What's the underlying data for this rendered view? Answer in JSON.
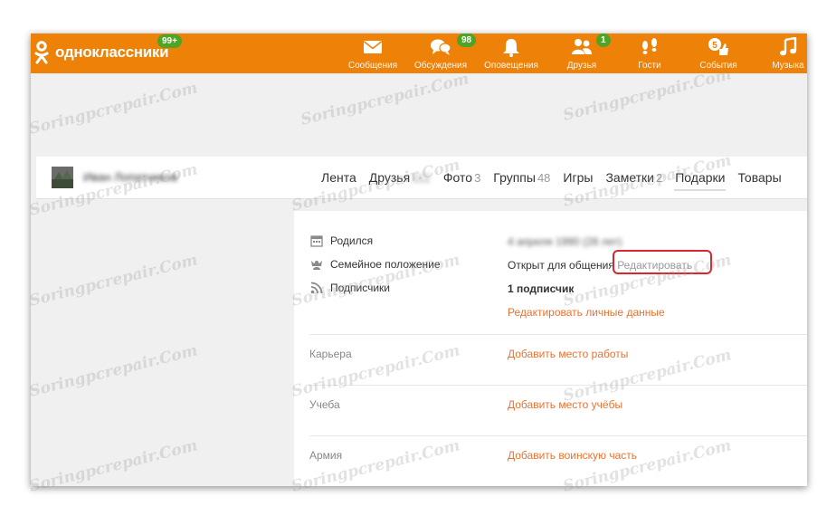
{
  "brand": {
    "name": "одноклассники",
    "badge": "99+"
  },
  "nav": [
    {
      "id": "messages",
      "label": "Сообщения",
      "icon": "envelope-icon",
      "badge": ""
    },
    {
      "id": "discussions",
      "label": "Обсуждения",
      "icon": "chat-bubbles-icon",
      "badge": "98"
    },
    {
      "id": "notifications",
      "label": "Оповещения",
      "icon": "bell-icon",
      "badge": ""
    },
    {
      "id": "friends",
      "label": "Друзья",
      "icon": "people-icon",
      "badge": "1"
    },
    {
      "id": "guests",
      "label": "Гости",
      "icon": "footprints-icon",
      "badge": ""
    },
    {
      "id": "events",
      "label": "События",
      "icon": "thumbs-up-five-icon",
      "badge": ""
    },
    {
      "id": "music",
      "label": "Музыка",
      "icon": "music-note-icon",
      "badge": ""
    }
  ],
  "profile": {
    "name": "Иван Лопатников",
    "tabs": [
      {
        "label": "Лента",
        "count": ""
      },
      {
        "label": "Друзья",
        "count": "112"
      },
      {
        "label": "Фото",
        "count": "3"
      },
      {
        "label": "Группы",
        "count": "48"
      },
      {
        "label": "Игры",
        "count": ""
      },
      {
        "label": "Заметки",
        "count": "2"
      },
      {
        "label": "Подарки",
        "count": ""
      },
      {
        "label": "Товары",
        "count": ""
      }
    ]
  },
  "about": {
    "born_label": "Родился",
    "born_value": "4 апреля 1990 (28 лет)",
    "family_label": "Семейное положение",
    "family_value": "Открыт для общения",
    "edit_label": "Редактировать",
    "subscribers_label": "Подписчики",
    "subscribers_value": "1 подписчик",
    "edit_personal_link": "Редактировать личные данные"
  },
  "sections": {
    "career_label": "Карьера",
    "career_link": "Добавить место работы",
    "study_label": "Учеба",
    "study_link": "Добавить место учёбы",
    "army_label": "Армия",
    "army_link": "Добавить воинскую часть"
  },
  "watermark": "Soringpcrepair.Com",
  "colors": {
    "brand": "#ee8208",
    "badge": "#4fa325",
    "link": "#eb722e",
    "highlight": "#d7282f"
  }
}
